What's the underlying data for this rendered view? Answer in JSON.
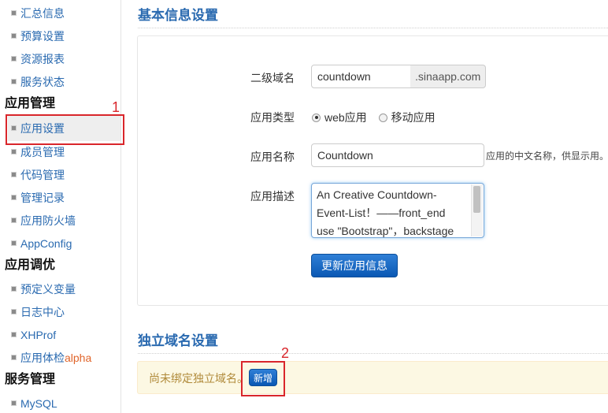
{
  "sidebar": {
    "items": [
      {
        "label": "汇总信息"
      },
      {
        "label": "预算设置"
      },
      {
        "label": "资源报表"
      },
      {
        "label": "服务状态"
      },
      {
        "label": "应用设置"
      },
      {
        "label": "成员管理"
      },
      {
        "label": "代码管理"
      },
      {
        "label": "管理记录"
      },
      {
        "label": "应用防火墙"
      },
      {
        "label": "AppConfig"
      },
      {
        "label": "预定义变量"
      },
      {
        "label": "日志中心"
      },
      {
        "label": "XHProf"
      },
      {
        "label": "应用体检",
        "suffix": "alpha"
      },
      {
        "label": "MySQL"
      }
    ],
    "headings": [
      "应用管理",
      "应用调优",
      "服务管理"
    ],
    "active": "应用设置"
  },
  "annotations": {
    "marker1": "1",
    "marker2": "2"
  },
  "basic": {
    "title": "基本信息设置",
    "domain_label": "二级域名",
    "domain_value": "countdown",
    "domain_suffix": ".sinaapp.com",
    "type_label": "应用类型",
    "type_options": [
      "web应用",
      "移动应用"
    ],
    "type_selected": "web应用",
    "name_label": "应用名称",
    "name_value": "Countdown",
    "name_hint": "应用的中文名称，供显示用。",
    "desc_label": "应用描述",
    "desc_lines": [
      "An Creative Countdown-",
      "Event-List！——front_end",
      "use \"Bootstrap\"，backstage"
    ],
    "update_button": "更新应用信息"
  },
  "custom_domain": {
    "title": "独立域名设置",
    "notice": "尚未绑定独立域名。",
    "add_button": "新增"
  },
  "colors": {
    "accent": "#2a6ab0",
    "primary_button": "#0a58b4",
    "annotation_red": "#d9262b",
    "notice_bg": "#fcf8e3"
  }
}
